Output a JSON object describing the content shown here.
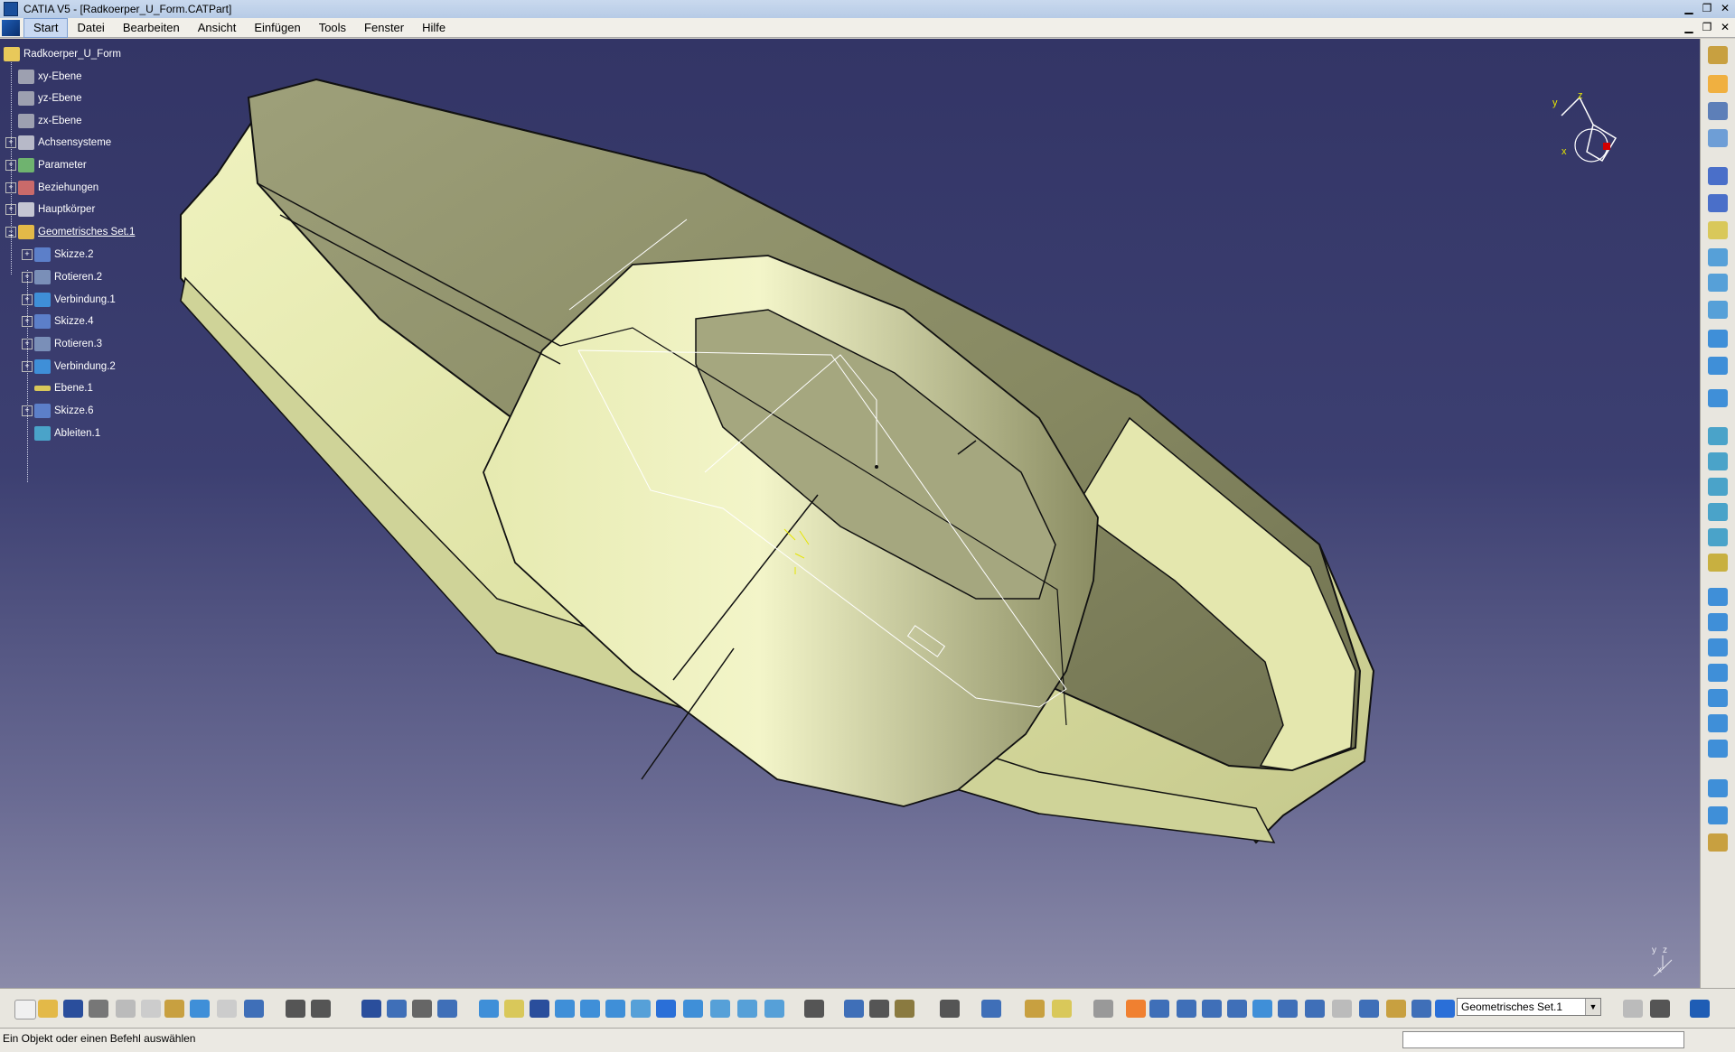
{
  "window": {
    "title": "CATIA V5 - [Radkoerper_U_Form.CATPart]",
    "min": "▁",
    "max": "❐",
    "close": "✕"
  },
  "menu": [
    "Start",
    "Datei",
    "Bearbeiten",
    "Ansicht",
    "Einfügen",
    "Tools",
    "Fenster",
    "Hilfe"
  ],
  "tree": {
    "root": "Radkoerper_U_Form",
    "items": [
      {
        "label": "xy-Ebene",
        "icon": "plane-icon"
      },
      {
        "label": "yz-Ebene",
        "icon": "plane-icon"
      },
      {
        "label": "zx-Ebene",
        "icon": "plane-icon"
      },
      {
        "label": "Achsensysteme",
        "icon": "axis-system-icon"
      },
      {
        "label": "Parameter",
        "icon": "parameter-icon"
      },
      {
        "label": "Beziehungen",
        "icon": "relations-icon"
      },
      {
        "label": "Hauptkörper",
        "icon": "body-icon"
      },
      {
        "label": "Geometrisches Set.1",
        "icon": "geometric-set-icon"
      },
      {
        "label": "Skizze.2",
        "icon": "sketch-icon"
      },
      {
        "label": "Rotieren.2",
        "icon": "revolve-icon"
      },
      {
        "label": "Verbindung.1",
        "icon": "join-icon"
      },
      {
        "label": "Skizze.4",
        "icon": "sketch-icon"
      },
      {
        "label": "Rotieren.3",
        "icon": "revolve-icon"
      },
      {
        "label": "Verbindung.2",
        "icon": "join-icon"
      },
      {
        "label": "Ebene.1",
        "icon": "plane-icon"
      },
      {
        "label": "Skizze.6",
        "icon": "sketch-icon"
      },
      {
        "label": "Ableiten.1",
        "icon": "extract-icon"
      }
    ]
  },
  "compass": {
    "x": "x",
    "y": "y",
    "z": "z"
  },
  "corner_axes": {
    "y": "y",
    "z": "z",
    "x": "x"
  },
  "toolbar": {
    "current_set": "Geometrisches Set.1",
    "dropdown_arrow": "▼"
  },
  "status": {
    "message": "Ein Objekt oder einen Befehl auswählen"
  },
  "colors": {
    "part": "#e8ebaf",
    "part_shadow": "#7d7f55",
    "background": "#333566",
    "accent": "#1f5db5"
  }
}
